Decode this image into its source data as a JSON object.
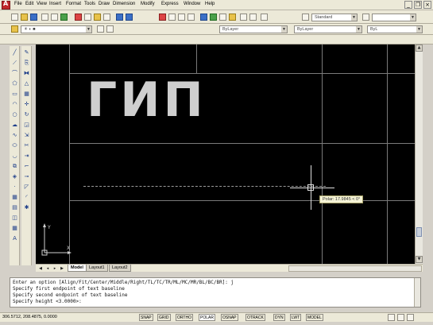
{
  "menu": {
    "items": [
      "File",
      "Edit",
      "View",
      "Insert",
      "Format",
      "Tools",
      "Draw",
      "Dimension",
      "Modify",
      "Express",
      "Window",
      "Help"
    ]
  },
  "toolbar": {
    "text_style": "Standard",
    "layer": "ByLayer",
    "linetype": "ByLayer",
    "lineweight": "ByL"
  },
  "canvas": {
    "text": "ГИП",
    "polar_tooltip": "Polar: 17.9845 < 0°"
  },
  "tabs": [
    "Model",
    "Layout1",
    "Layout2"
  ],
  "command_line": [
    "Enter an option [Align/Fit/Center/Middle/Right/TL/TC/TR/ML/MC/MR/BL/BC/BR]: j",
    "Specify first endpoint of text baseline",
    "Specify second endpoint of text baseline",
    "Specify height <3.0000>:"
  ],
  "status": {
    "coords": "306.5712, 208.4875, 0.0000",
    "buttons": [
      "SNAP",
      "GRID",
      "ORTHO",
      "POLAR",
      "OSNAP",
      "OTRACK",
      "DYN",
      "LWT",
      "MODEL"
    ]
  },
  "colors": {
    "canvas_bg": "#000000",
    "chrome_bg": "#ece9d8",
    "text_gray": "#cfcfcf"
  }
}
